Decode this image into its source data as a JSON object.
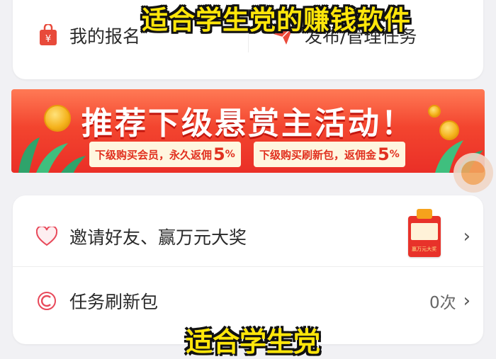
{
  "overlay": {
    "top_caption": "适合学生党的赚钱软件",
    "bottom_caption": "适合学生党"
  },
  "top_card": {
    "left_item": {
      "label": "我的报名",
      "icon": "bag-yen-icon"
    },
    "right_item": {
      "label": "发布/管理任务",
      "icon": "send-plane-icon"
    }
  },
  "banner": {
    "title": "推荐下级悬赏主活动！",
    "promo_left": {
      "text": "下级购买会员，永久返佣",
      "value": "5",
      "unit": "%"
    },
    "promo_right": {
      "text": "下级购买刷新包，返佣金",
      "value": "5",
      "unit": "%"
    }
  },
  "list": {
    "items": [
      {
        "label": "邀请好友、赢万元大奖",
        "icon": "heart-icon",
        "thumb_label": "赢万元大奖",
        "right_text": ""
      },
      {
        "label": "任务刷新包",
        "icon": "refresh-c-icon",
        "right_text": "0次"
      }
    ]
  },
  "colors": {
    "accent_red": "#ea2f27",
    "caption_yellow": "#ffe60a",
    "background": "#f1f1f4"
  }
}
